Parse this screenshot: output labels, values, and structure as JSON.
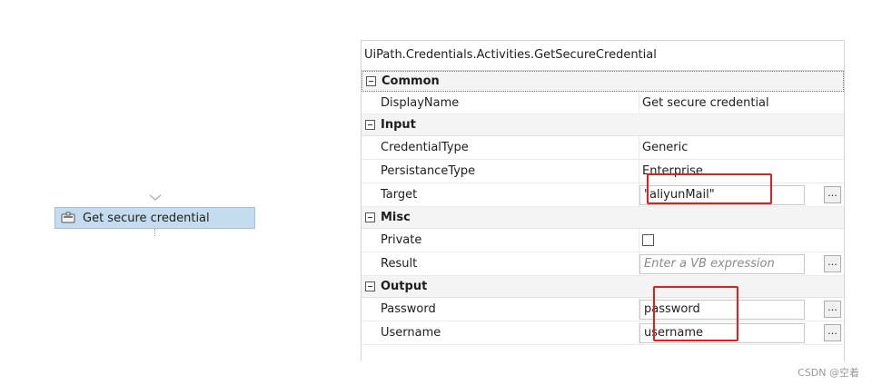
{
  "activity": {
    "label": "Get secure credential",
    "icon": "credential-activity-icon"
  },
  "panel": {
    "title": "UiPath.Credentials.Activities.GetSecureCredential",
    "categories": {
      "common": {
        "label": "Common"
      },
      "input": {
        "label": "Input"
      },
      "misc": {
        "label": "Misc"
      },
      "output": {
        "label": "Output"
      }
    },
    "props": {
      "display_name": {
        "name": "DisplayName",
        "value": "Get secure credential"
      },
      "credential_type": {
        "name": "CredentialType",
        "value": "Generic"
      },
      "persistance_type": {
        "name": "PersistanceType",
        "value": "Enterprise"
      },
      "target": {
        "name": "Target",
        "value": "\"aliyunMail\""
      },
      "private": {
        "name": "Private",
        "checked": false
      },
      "result": {
        "name": "Result",
        "placeholder": "Enter a VB expression"
      },
      "password": {
        "name": "Password",
        "value": "password"
      },
      "username": {
        "name": "Username",
        "value": "username"
      }
    },
    "ellipsis_label": "...",
    "highlight_color": "#e02020"
  },
  "watermark": "CSDN @空着"
}
